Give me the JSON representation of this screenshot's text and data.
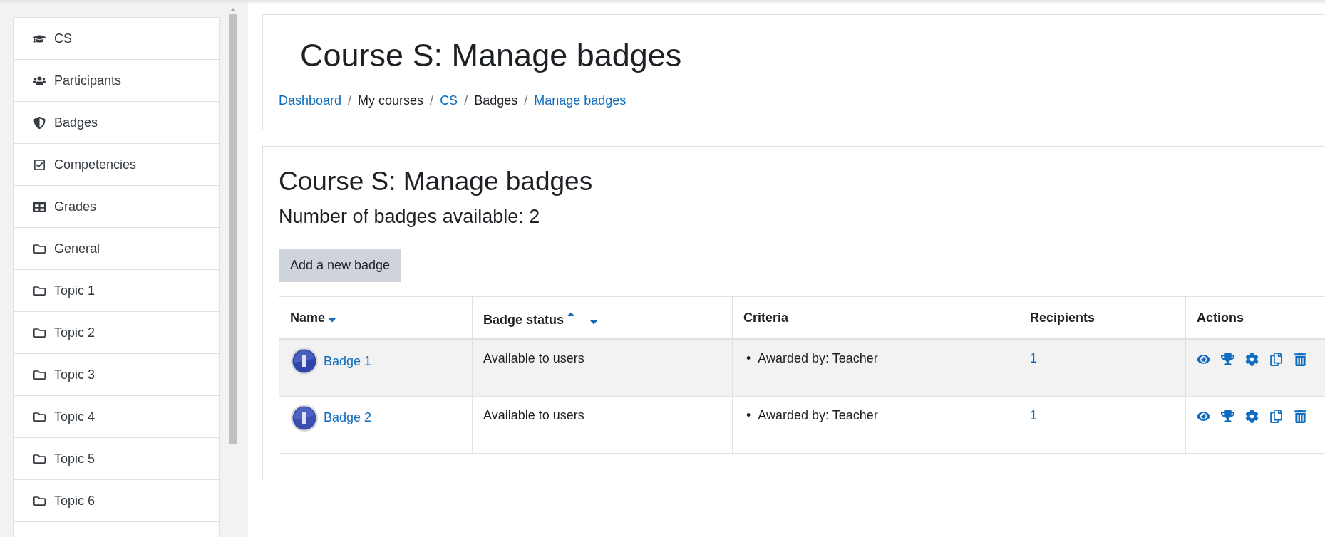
{
  "sidebar": {
    "items": [
      {
        "label": "CS",
        "kind": "course"
      },
      {
        "label": "Participants",
        "kind": "participants"
      },
      {
        "label": "Badges",
        "kind": "badges"
      },
      {
        "label": "Competencies",
        "kind": "competencies"
      },
      {
        "label": "Grades",
        "kind": "grades"
      },
      {
        "label": "General",
        "kind": "section"
      },
      {
        "label": "Topic 1",
        "kind": "section"
      },
      {
        "label": "Topic 2",
        "kind": "section"
      },
      {
        "label": "Topic 3",
        "kind": "section"
      },
      {
        "label": "Topic 4",
        "kind": "section"
      },
      {
        "label": "Topic 5",
        "kind": "section"
      },
      {
        "label": "Topic 6",
        "kind": "section"
      }
    ]
  },
  "header": {
    "title": "Course S: Manage badges",
    "separator": "/",
    "breadcrumb": [
      {
        "label": "Dashboard",
        "link": true
      },
      {
        "label": "My courses",
        "link": false
      },
      {
        "label": "CS",
        "link": true
      },
      {
        "label": "Badges",
        "link": false
      },
      {
        "label": "Manage badges",
        "link": true
      }
    ]
  },
  "content": {
    "heading": "Course S: Manage badges",
    "count_text": "Number of badges available: 2",
    "add_button": "Add a new badge"
  },
  "table": {
    "columns": [
      {
        "label": "Name",
        "sort_up": false,
        "sort_down": true
      },
      {
        "label": "Badge status",
        "sort_up": true,
        "sort_down": true
      },
      {
        "label": "Criteria",
        "sort_up": false,
        "sort_down": false
      },
      {
        "label": "Recipients",
        "sort_up": false,
        "sort_down": false
      },
      {
        "label": "Actions",
        "sort_up": false,
        "sort_down": false
      }
    ],
    "rows": [
      {
        "name": "Badge 1",
        "status": "Available to users",
        "criteria": [
          {
            "marker": "•",
            "text": "Awarded by: Teacher"
          }
        ],
        "recipients": "1"
      },
      {
        "name": "Badge 2",
        "status": "Available to users",
        "criteria": [
          {
            "marker": "•",
            "text": "Awarded by: Teacher"
          }
        ],
        "recipients": "1"
      }
    ]
  }
}
